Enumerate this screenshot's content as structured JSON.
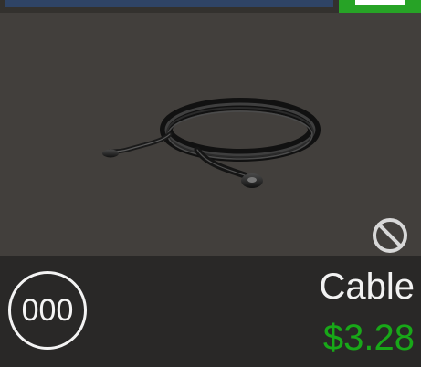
{
  "item": {
    "name": "Cable",
    "price": "$3.28",
    "count": "000",
    "icon_name": "cable-icon",
    "unavailable_icon_name": "ban-icon"
  },
  "colors": {
    "price_green": "#18a818",
    "button_green": "#27a326",
    "panel_blue": "#2f4466"
  }
}
